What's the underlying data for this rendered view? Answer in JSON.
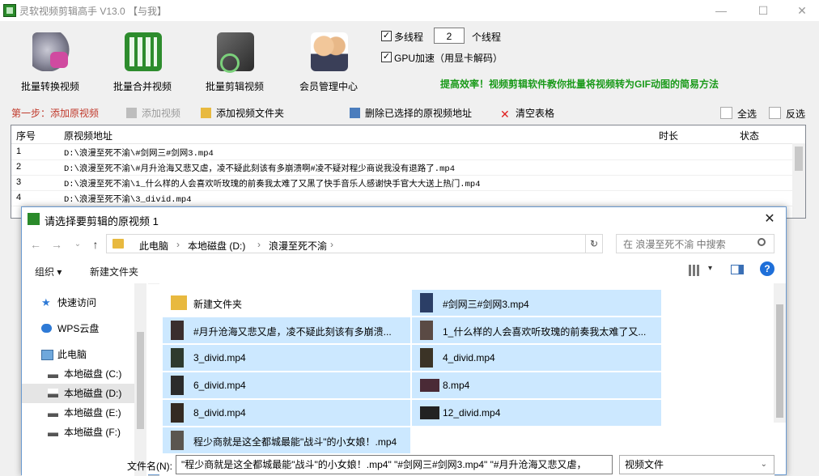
{
  "app": {
    "title": "灵软视频剪辑高手 V13.0  【与我】",
    "window_controls": {
      "minimize": "—",
      "maximize": "☐",
      "close": "✕"
    }
  },
  "toolbar": {
    "tools": [
      {
        "label": "批量转换视频",
        "icon": "video-convert-icon"
      },
      {
        "label": "批量合并视频",
        "icon": "film-merge-icon"
      },
      {
        "label": "批量剪辑视频",
        "icon": "film-cut-icon"
      },
      {
        "label": "会员管理中心",
        "icon": "members-icon"
      }
    ],
    "multithread": {
      "label": "多线程",
      "checked": true,
      "value": "2",
      "suffix": "个线程"
    },
    "gpu": {
      "label": "GPU加速（用显卡解码）",
      "checked": true
    },
    "promo": "提高效率！视频剪辑软件教你批量将视频转为GIF动图的简易方法"
  },
  "step1": {
    "label": "第一步：添加原视频",
    "add_video": "添加视频",
    "add_folder": "添加视频文件夹",
    "delete_selected": "删除已选择的原视频地址",
    "clear_table": "清空表格",
    "select_all": "全选",
    "invert": "反选"
  },
  "table": {
    "columns": [
      "序号",
      "原视频地址",
      "时长",
      "状态"
    ],
    "rows": [
      {
        "num": "1",
        "path": "D:\\浪漫至死不渝\\#剑网三#剑网3.mp4"
      },
      {
        "num": "2",
        "path": "D:\\浪漫至死不渝\\#月升沧海又悲又虐，凌不疑此刻该有多崩溃啊#凌不疑对程少商说我没有退路了.mp4"
      },
      {
        "num": "3",
        "path": "D:\\浪漫至死不渝\\1_什么样的人会喜欢听玫瑰的前奏我太难了又黑了快手音乐人感谢快手官大大送上热门.mp4"
      },
      {
        "num": "4",
        "path": "D:\\浪漫至死不渝\\3_divid.mp4"
      }
    ]
  },
  "dialog": {
    "title": "请选择要剪辑的原视频 1",
    "close": "✕",
    "breadcrumb": [
      "此电脑",
      "本地磁盘 (D:)",
      "浪漫至死不渝"
    ],
    "search_placeholder": "在 浪漫至死不渝 中搜索",
    "organize": "组织 ▾",
    "new_folder": "新建文件夹",
    "nav": [
      {
        "label": "快速访问",
        "icon": "star-icon"
      },
      {
        "label": "WPS云盘",
        "icon": "cloud-icon"
      },
      {
        "label": "此电脑",
        "icon": "computer-icon"
      },
      {
        "label": "本地磁盘 (C:)",
        "icon": "drive-icon"
      },
      {
        "label": "本地磁盘 (D:)",
        "icon": "drive-icon"
      },
      {
        "label": "本地磁盘 (E:)",
        "icon": "drive-icon"
      },
      {
        "label": "本地磁盘 (F:)",
        "icon": "drive-icon"
      }
    ],
    "files": [
      {
        "name": "新建文件夹",
        "type": "folder",
        "selected": false
      },
      {
        "name": "#剑网三#剑网3.mp4",
        "type": "video",
        "selected": true
      },
      {
        "name": "#月升沧海又悲又虐，凌不疑此刻该有多崩溃...",
        "type": "video",
        "selected": true
      },
      {
        "name": "1_什么样的人会喜欢听玫瑰的前奏我太难了又...",
        "type": "video",
        "selected": true
      },
      {
        "name": "3_divid.mp4",
        "type": "video",
        "selected": true
      },
      {
        "name": "4_divid.mp4",
        "type": "video",
        "selected": true
      },
      {
        "name": "6_divid.mp4",
        "type": "video",
        "selected": true
      },
      {
        "name": "8.mp4",
        "type": "video",
        "selected": true
      },
      {
        "name": "8_divid.mp4",
        "type": "video",
        "selected": true
      },
      {
        "name": "12_divid.mp4",
        "type": "video",
        "selected": true
      },
      {
        "name": "程少商就是这全都城最能\"战斗\"的小女娘！.mp4",
        "type": "video",
        "selected": true
      }
    ],
    "filename_label": "文件名(N):",
    "filename_value": "\"程少商就是这全都城最能\"战斗\"的小女娘！.mp4\" \"#剑网三#剑网3.mp4\" \"#月升沧海又悲又虐，",
    "filetype": "视频文件"
  }
}
